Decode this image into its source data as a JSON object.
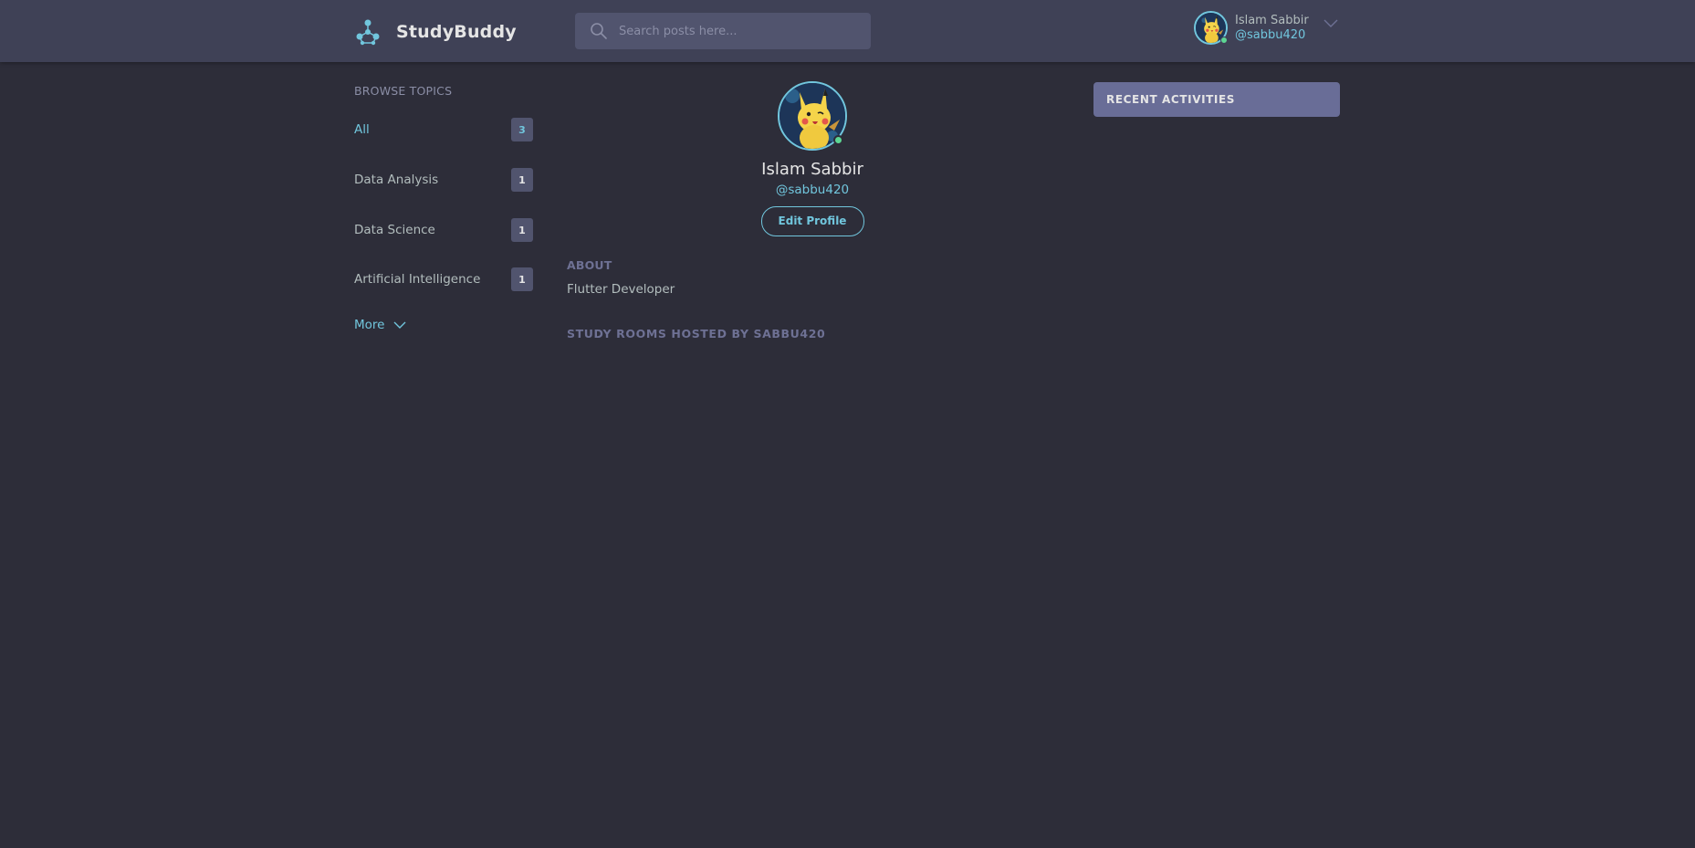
{
  "header": {
    "app_name": "StudyBuddy",
    "search_placeholder": "Search posts here...",
    "user": {
      "name": "Islam Sabbir",
      "handle": "@sabbu420"
    }
  },
  "sidebar": {
    "title": "BROWSE TOPICS",
    "topics": [
      {
        "label": "All",
        "count": "3",
        "active": true
      },
      {
        "label": "Data Analysis",
        "count": "1",
        "active": false
      },
      {
        "label": "Data Science",
        "count": "1",
        "active": false
      },
      {
        "label": "Artificial Intelligence",
        "count": "1",
        "active": false
      }
    ],
    "more_label": "More"
  },
  "profile": {
    "name": "Islam Sabbir",
    "handle": "@sabbu420",
    "edit_label": "Edit Profile",
    "about_title": "ABOUT",
    "about_text": "Flutter Developer",
    "rooms_title": "STUDY ROOMS HOSTED BY SABBU420"
  },
  "activities": {
    "title": "RECENT ACTIVITIES"
  },
  "colors": {
    "background": "#2d2d39",
    "header": "#3f4156",
    "accent": "#71c6dd",
    "panel": "#696d97",
    "online": "#5dd693"
  }
}
